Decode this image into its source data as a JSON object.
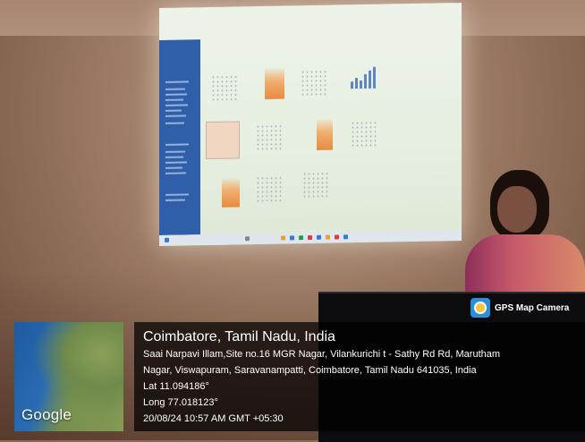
{
  "overlay": {
    "app_name": "GPS Map Camera",
    "map_provider": "Google",
    "location_title": "Coimbatore, Tamil Nadu, India",
    "address_line_1": "Saai Narpavi Illam,Site no.16 MGR Nagar, Vilankurichi t - Sathy Rd Rd, Marutham",
    "address_line_2": "Nagar, Viswapuram, Saravanampatti, Coimbatore, Tamil Nadu 641035, India",
    "latitude": "Lat 11.094186°",
    "longitude": "Long 77.018123°",
    "timestamp": "20/08/24 10:57 AM GMT +05:30"
  },
  "colors": {
    "projector_sidebar": "#2f5fa8",
    "overlay_background": "#000000",
    "overlay_text": "#ffffff"
  }
}
